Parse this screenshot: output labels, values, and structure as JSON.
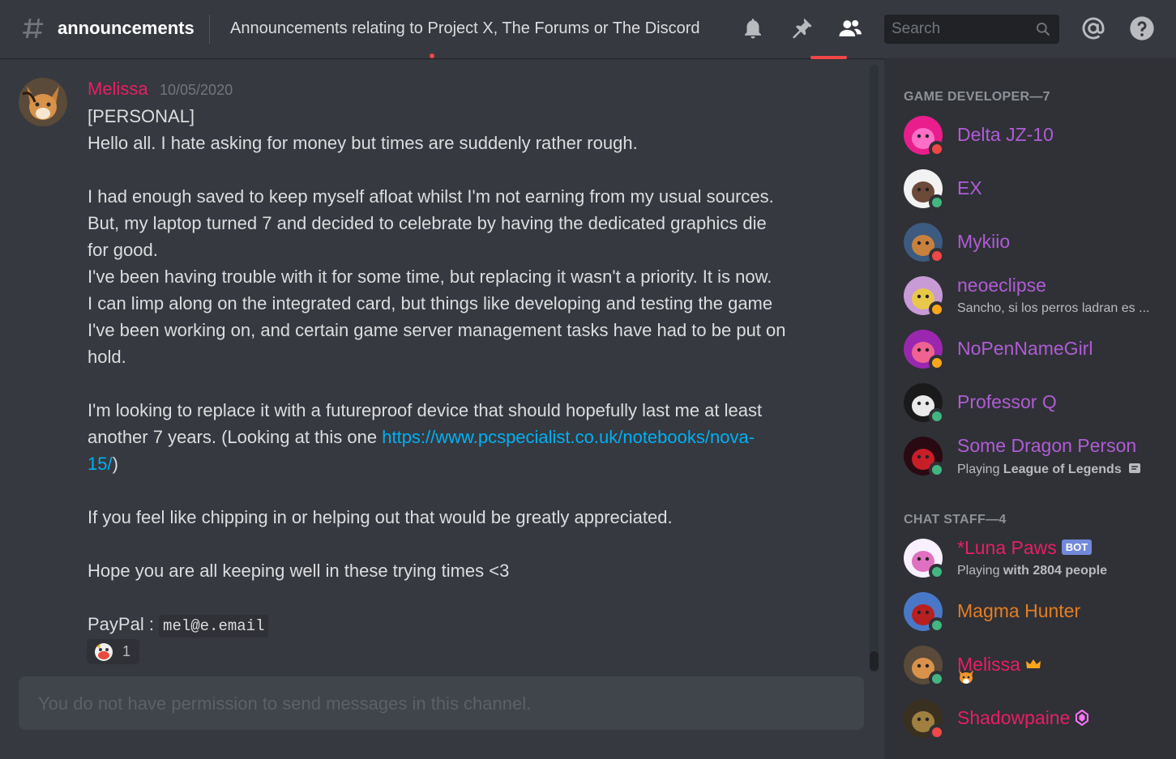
{
  "header": {
    "channel_name": "announcements",
    "topic": "Announcements relating to Project X, The Forums or The Discord",
    "search_placeholder": "Search"
  },
  "message": {
    "author": "Melissa",
    "timestamp": "10/05/2020",
    "lines": [
      "[PERSONAL]",
      "Hello all. I hate asking for money but times are suddenly rather rough.",
      "",
      "I had enough saved to keep myself afloat whilst I'm not earning from my usual sources.",
      "But, my laptop turned 7 and decided to celebrate by having the dedicated graphics die",
      "for good.",
      "I've been having trouble with it for some time, but replacing it wasn't a priority. It is now.",
      "I can limp along on the integrated card, but things like developing and testing the game",
      "I've been working on, and certain game server management tasks have had to be put on",
      "hold.",
      "",
      "I'm looking to replace it with a futureproof device that should hopefully last me at least"
    ],
    "link_prefix": "another 7 years. (Looking at this one ",
    "link_line1": "https://www.pcspecialist.co.uk/notebooks/nova-",
    "link_line2": "15/",
    "link_suffix": ")",
    "lines_after": [
      "",
      "If you feel like chipping in or helping out that would be greatly appreciated.",
      "",
      "Hope you are all keeping well in these trying times <3",
      ""
    ],
    "paypal_label": "PayPal : ",
    "paypal_email": "mel@e.email",
    "reaction_count": "1"
  },
  "composer": {
    "placeholder": "You do not have permission to send messages in this channel."
  },
  "members": {
    "groups": [
      {
        "title": "GAME DEVELOPER—7"
      },
      {
        "title": "CHAT STAFF—4"
      }
    ],
    "list": [
      {
        "name": "Delta JZ-10",
        "color": "#b05cd6",
        "status": "dnd"
      },
      {
        "name": "EX",
        "color": "#b05cd6",
        "status": "online"
      },
      {
        "name": "Mykiio",
        "color": "#b05cd6",
        "status": "dnd"
      },
      {
        "name": "neoeclipse",
        "color": "#b05cd6",
        "status": "idle",
        "activity": "Sancho, si los perros ladran es ..."
      },
      {
        "name": "NoPenNameGirl",
        "color": "#b05cd6",
        "status": "idle"
      },
      {
        "name": "Professor Q",
        "color": "#b05cd6",
        "status": "online"
      },
      {
        "name": "Some Dragon Person",
        "color": "#b05cd6",
        "status": "online",
        "activity_prefix": "Playing ",
        "activity_bold": "League of Legends"
      },
      {
        "name": "*Luna Paws",
        "color": "#e91e63",
        "status": "online",
        "bot_tag": "BOT",
        "activity_prefix": "Playing ",
        "activity_bold": "with 2804 people"
      },
      {
        "name": "Magma Hunter",
        "color": "#e67e22",
        "status": "online"
      },
      {
        "name": "Melissa",
        "color": "#e91e63",
        "status": "online"
      },
      {
        "name": "Shadowpaine",
        "color": "#e91e63",
        "status": "dnd"
      }
    ]
  },
  "colors": {
    "online": "#43b581",
    "dnd": "#f04747",
    "idle": "#faa61a",
    "link": "#00b0f4",
    "role_game_dev": "#b05cd6",
    "role_staff": "#e91e63"
  }
}
